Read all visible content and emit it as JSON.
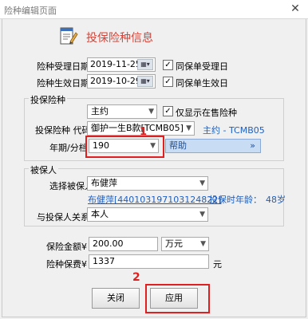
{
  "window": {
    "title": "险种编辑页面",
    "close_glyph": "✕"
  },
  "header": {
    "title": "投保险种信息",
    "icon": "notepad-pencil-icon"
  },
  "dates": {
    "accept_label": "险种受理日期",
    "accept_value": "2019-11-25",
    "accept_check_label": "同保单受理日",
    "accept_checked": "✓",
    "effective_label": "险种生效日期",
    "effective_value": "2019-10-29",
    "effective_check_label": "同保单生效日",
    "effective_checked": "✓",
    "cal_glyph": "▦▾"
  },
  "insured_product": {
    "group_title": "投保险种",
    "main_rider_value": "主约",
    "only_on_sale_label": "仅显示在售险种",
    "only_on_sale_checked": "✓",
    "code_label": "投保险种 代码",
    "code_value": "御护一生B款[TCMB05]",
    "code_link": "主约 - TCMB05",
    "term_label": "年期/分档",
    "term_value": "190",
    "help_value": "帮助",
    "help_glyph": "»"
  },
  "insured_person": {
    "group_title": "被保人",
    "select_label": "选择被保人",
    "select_value": "布健萍",
    "id_link": "布健萍[440103197103124822]",
    "age_text": "投保时年龄：",
    "age_value": "48岁",
    "relation_label": "与投保人关系",
    "relation_value": "本人"
  },
  "amounts": {
    "sum_label": "保险金额¥",
    "sum_value": "200.00",
    "sum_unit": "万元",
    "premium_label": "险种保费¥",
    "premium_value": "1337",
    "premium_unit": "元"
  },
  "buttons": {
    "close_label": "关闭",
    "apply_label": "应用"
  },
  "annotations": {
    "mark1": "1",
    "mark2": "2"
  },
  "colors": {
    "header_title": "#d4453a",
    "link": "#1f5fbf",
    "highlight": "#e02020"
  }
}
